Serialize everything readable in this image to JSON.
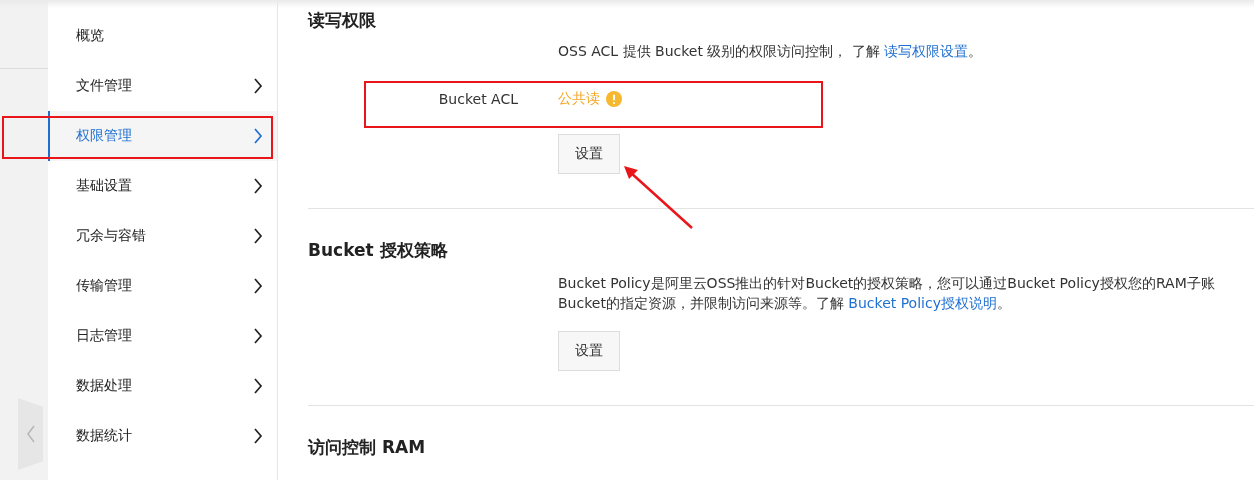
{
  "sidebar": {
    "items": [
      {
        "label": "概览",
        "selected": false,
        "has_children": false
      },
      {
        "label": "文件管理",
        "selected": false,
        "has_children": true
      },
      {
        "label": "权限管理",
        "selected": true,
        "has_children": true
      },
      {
        "label": "基础设置",
        "selected": false,
        "has_children": true
      },
      {
        "label": "冗余与容错",
        "selected": false,
        "has_children": true
      },
      {
        "label": "传输管理",
        "selected": false,
        "has_children": true
      },
      {
        "label": "日志管理",
        "selected": false,
        "has_children": true
      },
      {
        "label": "数据处理",
        "selected": false,
        "has_children": true
      },
      {
        "label": "数据统计",
        "selected": false,
        "has_children": true
      }
    ]
  },
  "sections": [
    {
      "title": "读写权限",
      "description_lines": [
        "OSS ACL 提供 Bucket 级别的权限访问控制， 了解 "
      ],
      "link": "读写权限设置",
      "after_link": "。",
      "field": {
        "label": "Bucket ACL",
        "value": "公共读",
        "warning": true
      },
      "button": "设置"
    },
    {
      "title": "Bucket 授权策略",
      "description_lines": [
        "Bucket Policy是阿里云OSS推出的针对Bucket的授权策略，您可以通过Bucket Policy授权您的RAM子账",
        "Bucket的指定资源，并限制访问来源等。了解 "
      ],
      "link": "Bucket Policy授权说明",
      "after_link": "。",
      "button": "设置"
    },
    {
      "title": "访问控制 RAM"
    }
  ]
}
